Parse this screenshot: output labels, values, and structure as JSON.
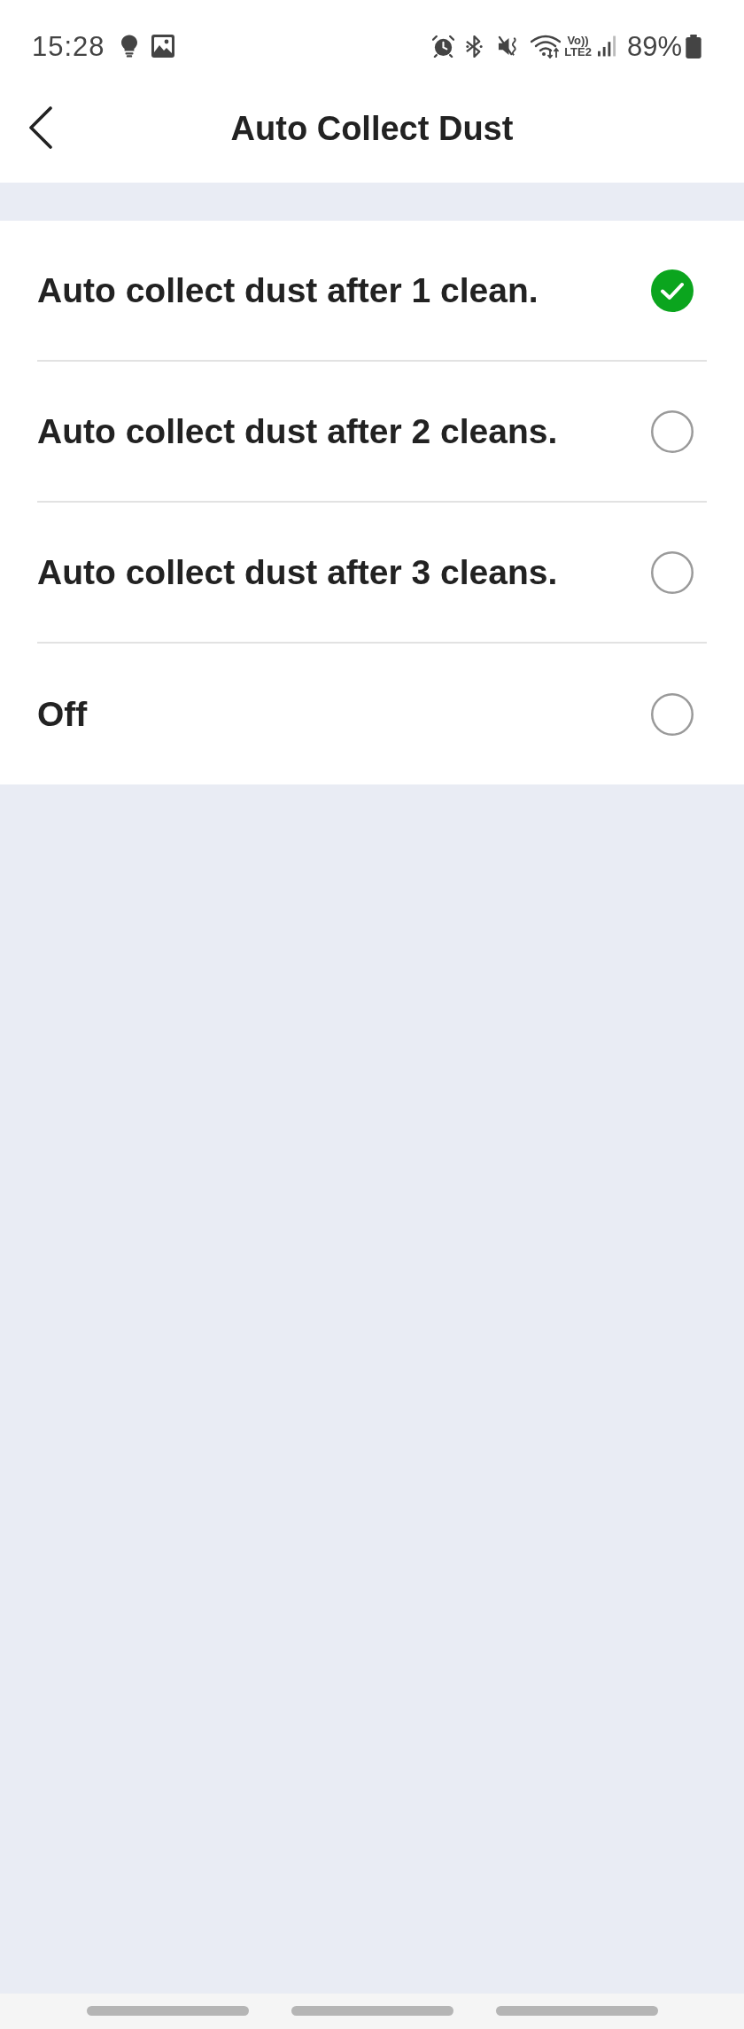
{
  "status_bar": {
    "time": "15:28",
    "network_label": {
      "top": "Vo))",
      "bottom": "LTE2"
    },
    "battery": "89%"
  },
  "header": {
    "title": "Auto Collect Dust"
  },
  "options": [
    {
      "label": "Auto collect dust after 1 clean.",
      "selected": true
    },
    {
      "label": "Auto collect dust after 2 cleans.",
      "selected": false
    },
    {
      "label": "Auto collect dust after 3 cleans.",
      "selected": false
    },
    {
      "label": "Off",
      "selected": false
    }
  ]
}
